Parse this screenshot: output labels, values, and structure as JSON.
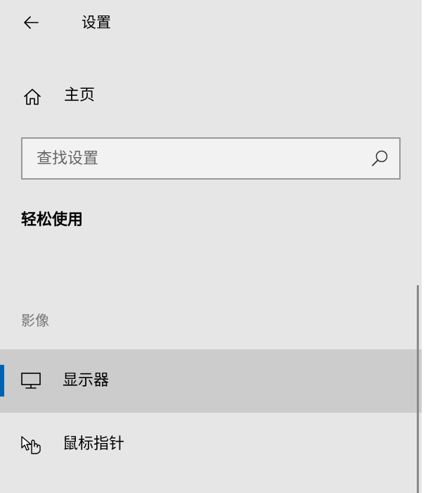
{
  "header": {
    "back_icon": "arrow-left-icon",
    "title": "设置"
  },
  "home": {
    "icon": "home-icon",
    "label": "主页"
  },
  "search": {
    "placeholder": "查找设置",
    "value": "",
    "icon": "search-icon"
  },
  "section": {
    "title": "轻松使用"
  },
  "groups": [
    {
      "label": "影像",
      "items": [
        {
          "label": "显示器",
          "icon": "monitor-icon",
          "selected": true
        },
        {
          "label": "鼠标指针",
          "icon": "mouse-pointer-hand-icon",
          "selected": false
        }
      ]
    }
  ],
  "colors": {
    "pane_background": "#e6e6e6",
    "selected_background": "#cccccc",
    "accent": "#0063b1",
    "group_label": "#767676",
    "search_border": "#999999"
  }
}
